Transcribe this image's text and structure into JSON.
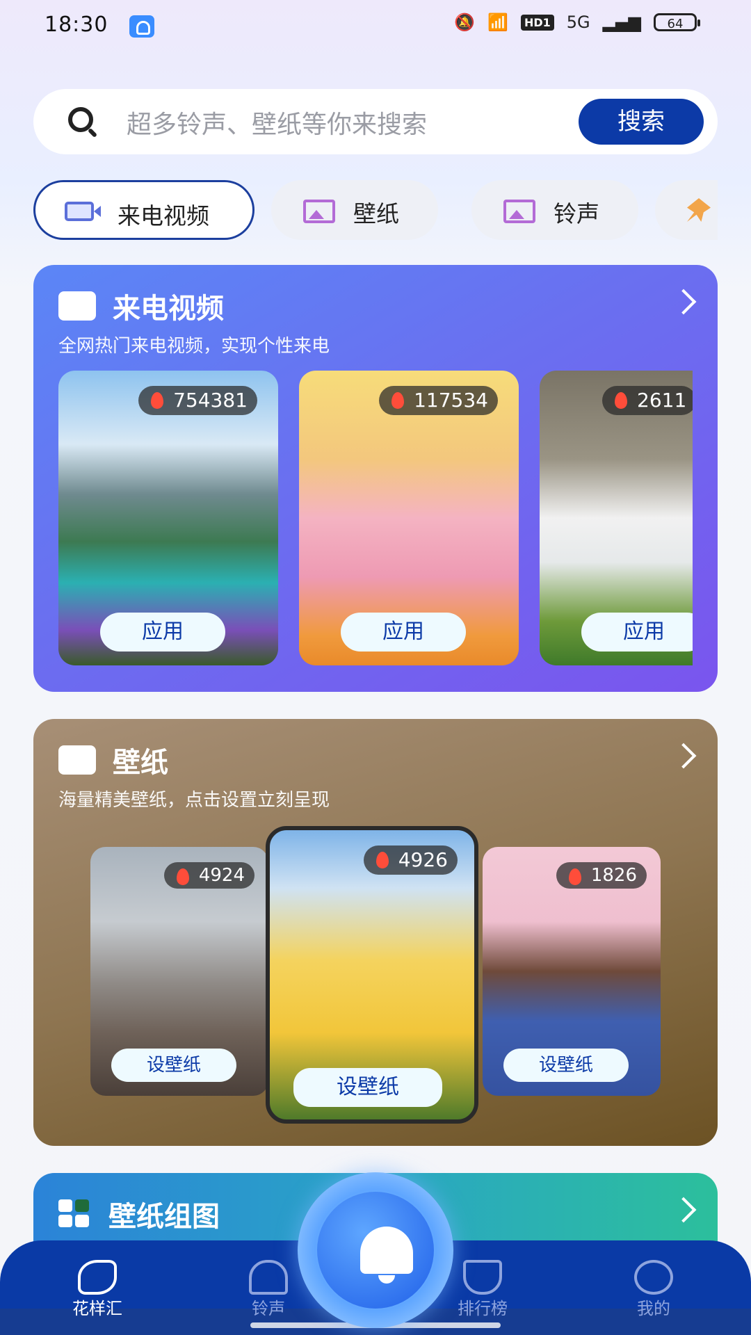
{
  "status_bar": {
    "time": "18:30",
    "hd_label": "HD1",
    "network_label": "5G",
    "battery": "64"
  },
  "search": {
    "placeholder": "超多铃声、壁纸等你来搜索",
    "button_label": "搜索"
  },
  "tabs": [
    {
      "label": "来电视频",
      "icon": "video-camera-icon",
      "active": true
    },
    {
      "label": "壁纸",
      "icon": "image-icon",
      "active": false
    },
    {
      "label": "铃声",
      "icon": "image-icon",
      "active": false
    },
    {
      "label": "",
      "icon": "pin-icon",
      "active": false
    }
  ],
  "video_section": {
    "title": "来电视频",
    "subtitle": "全网热门来电视频，实现个性来电",
    "items": [
      {
        "count": "754381",
        "apply_label": "应用",
        "scene": "mountain-lake"
      },
      {
        "count": "117534",
        "apply_label": "应用",
        "scene": "girl-flowers"
      },
      {
        "count": "2611",
        "apply_label": "应用",
        "scene": "white-kitten"
      }
    ]
  },
  "wallpaper_section": {
    "title": "壁纸",
    "subtitle": "海量精美壁纸，点击设置立刻呈现",
    "items": [
      {
        "count": "4924",
        "set_label": "设壁纸",
        "scene": "rain-umbrella"
      },
      {
        "count": "4926",
        "set_label": "设壁纸",
        "scene": "sunflower-girl"
      },
      {
        "count": "1826",
        "set_label": "设壁纸",
        "scene": "cherry-blossom"
      }
    ]
  },
  "group_section": {
    "title": "壁纸组图"
  },
  "bottom_nav": [
    {
      "label": "花样汇",
      "active": true
    },
    {
      "label": "铃声",
      "active": false
    },
    {
      "label": "排行榜",
      "active": false
    },
    {
      "label": "我的",
      "active": false
    }
  ],
  "colors": {
    "brand": "#0c3aa7",
    "video_card": "#6a6ff0",
    "wallpaper_card": "#8e7551",
    "group_card": "#2aa5c5"
  }
}
